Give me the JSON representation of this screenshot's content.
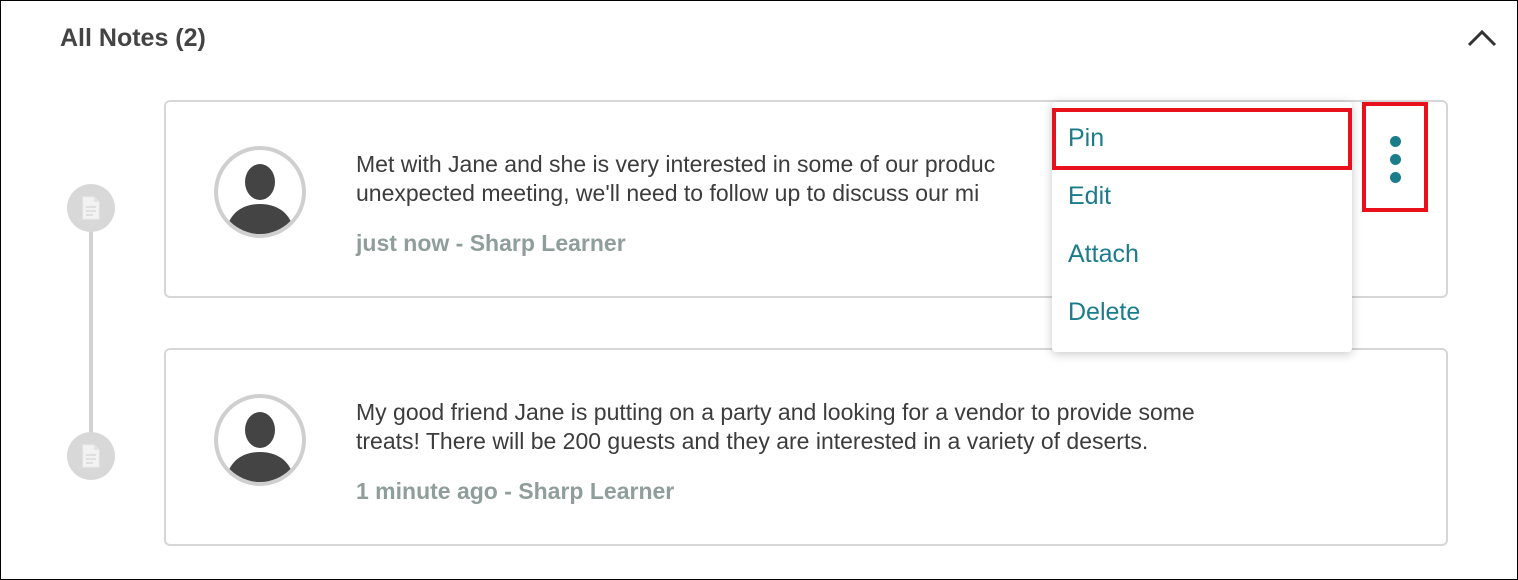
{
  "header": {
    "title": "All Notes (2)"
  },
  "notes": [
    {
      "text": "Met with Jane and she is very interested in some of our produc\nunexpected meeting, we'll need to follow up to discuss our mi",
      "meta": "just now - Sharp Learner"
    },
    {
      "text": "My good friend Jane is putting on a party and looking for a vendor to provide some\ntreats! There will be 200 guests and they are interested in a variety of deserts.",
      "meta": "1 minute ago - Sharp Learner"
    }
  ],
  "menu": {
    "items": [
      "Pin",
      "Edit",
      "Attach",
      "Delete"
    ]
  },
  "colors": {
    "accent": "#1a7c8c",
    "highlight": "#e8101a",
    "meta": "#8f9d9b"
  },
  "icons": {
    "collapse": "chevron-up-icon",
    "timeline": "document-icon",
    "more": "kebab-menu-icon",
    "avatar": "user-silhouette-icon"
  }
}
